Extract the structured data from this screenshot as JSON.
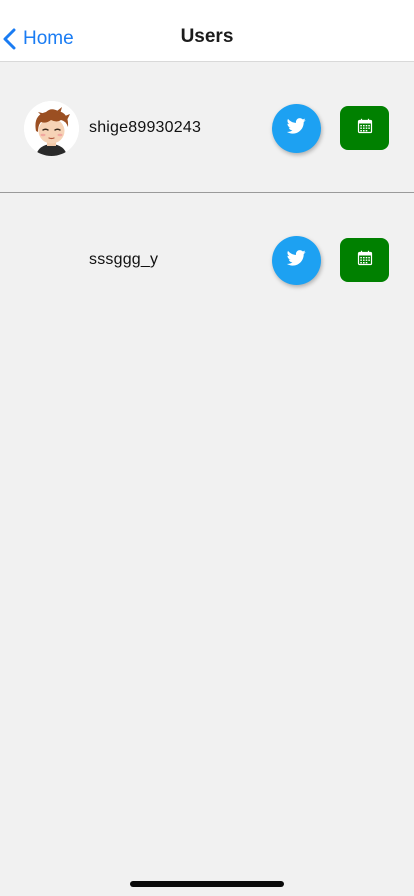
{
  "navbar": {
    "back_label": "Home",
    "title": "Users",
    "accent_color": "#1a7cf3"
  },
  "users": [
    {
      "username": "shige89930243",
      "has_avatar": true
    },
    {
      "username": "sssggg_y",
      "has_avatar": false
    }
  ],
  "actions": {
    "twitter_icon": "twitter-bird-icon",
    "twitter_color": "#1da1f2",
    "calendar_icon": "calendar-icon",
    "calendar_color": "#008000"
  }
}
